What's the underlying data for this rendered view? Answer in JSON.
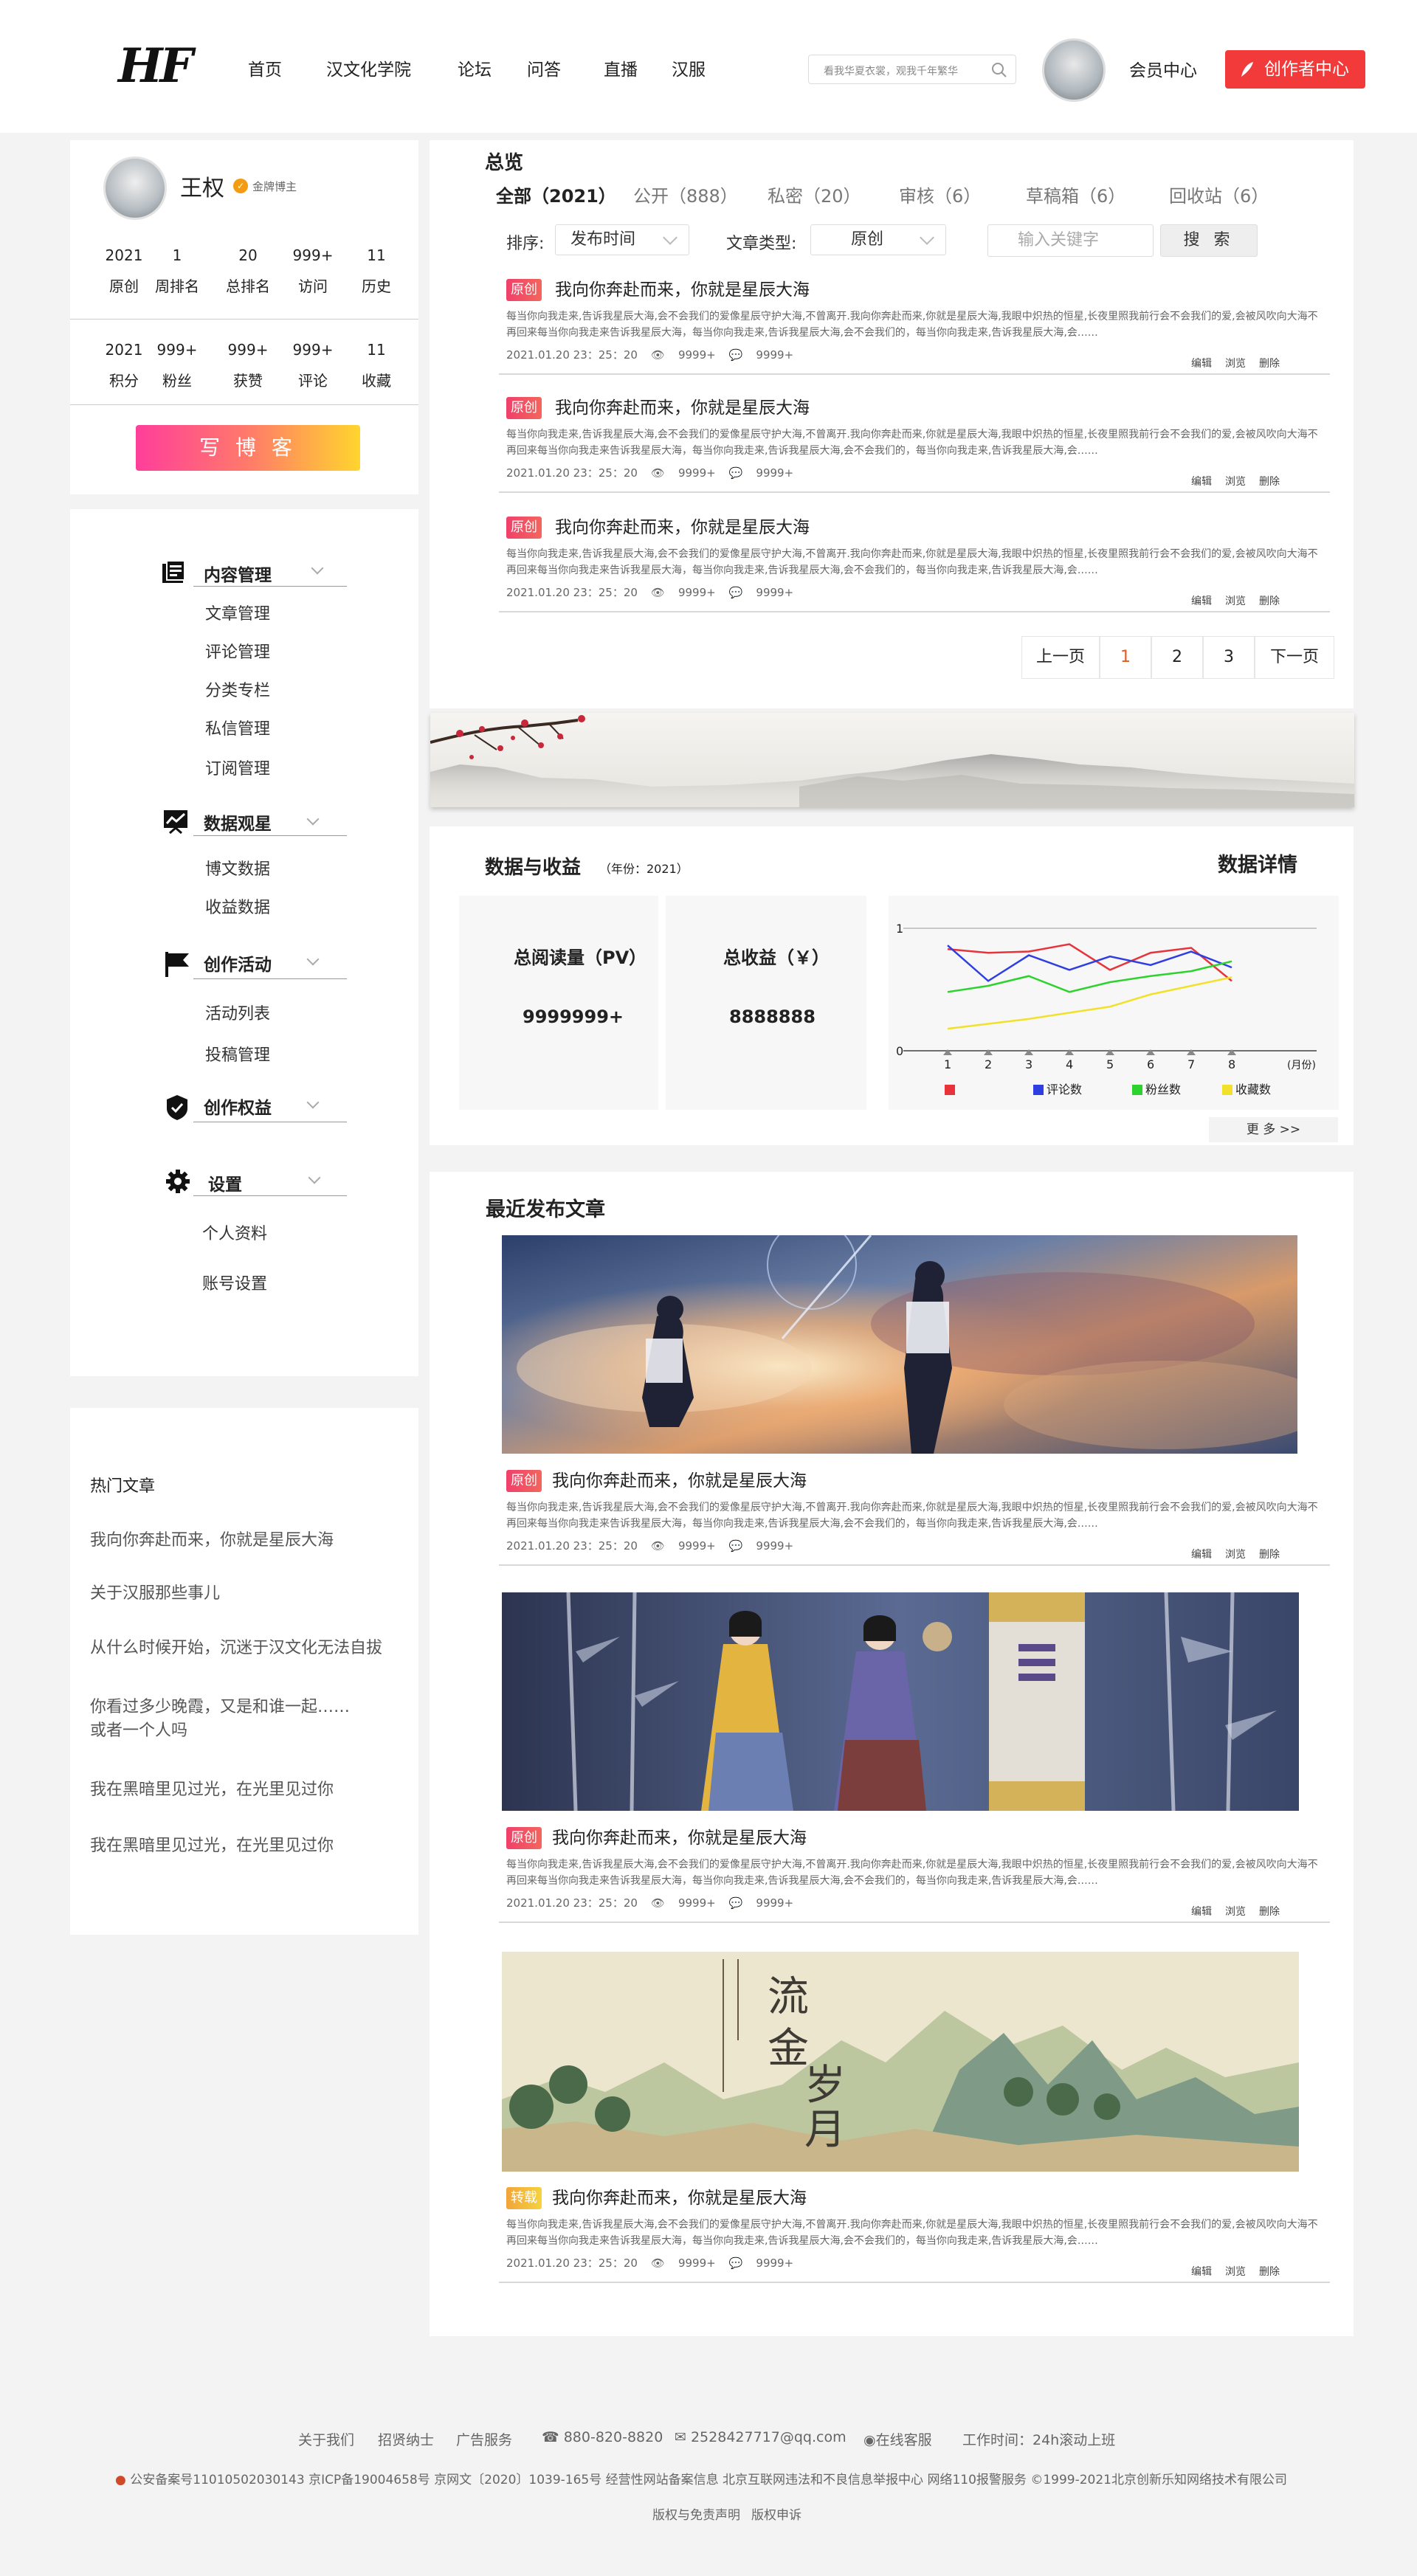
{
  "header": {
    "logo": "HF",
    "nav": [
      "首页",
      "汉文化学院",
      "论坛",
      "问答",
      "直播",
      "汉服"
    ],
    "search_placeholder": "看我华夏衣裳，观我千年繁华",
    "member_center": "会员中心",
    "creator_center": "创作者中心"
  },
  "profile": {
    "name": "王权",
    "badge": "金牌博主",
    "stats_row1": [
      {
        "value": "2021",
        "label": "原创"
      },
      {
        "value": "1",
        "label": "周排名"
      },
      {
        "value": "20",
        "label": "总排名"
      },
      {
        "value": "999+",
        "label": "访问"
      },
      {
        "value": "11",
        "label": "历史"
      }
    ],
    "stats_row2": [
      {
        "value": "2021",
        "label": "积分"
      },
      {
        "value": "999+",
        "label": "粉丝"
      },
      {
        "value": "999+",
        "label": "获赞"
      },
      {
        "value": "999+",
        "label": "评论"
      },
      {
        "value": "11",
        "label": "收藏"
      }
    ],
    "write_button": "写 博 客"
  },
  "menu": {
    "sections": [
      {
        "title": "内容管理",
        "icon": "document-icon",
        "items": [
          "文章管理",
          "评论管理",
          "分类专栏",
          "私信管理",
          "订阅管理"
        ]
      },
      {
        "title": "数据观星",
        "icon": "chart-icon",
        "items": [
          "博文数据",
          "收益数据"
        ]
      },
      {
        "title": "创作活动",
        "icon": "flag-icon",
        "items": [
          "活动列表",
          "投稿管理"
        ]
      },
      {
        "title": "创作权益",
        "icon": "medal-icon",
        "items": []
      },
      {
        "title": "设置",
        "icon": "gear-icon",
        "items": [
          "个人资料",
          "账号设置"
        ]
      }
    ]
  },
  "hot": {
    "title": "热门文章",
    "items": [
      "我向你奔赴而来，你就是星辰大海",
      "关于汉服那些事儿",
      "从什么时候开始，沉迷于汉文化无法自拔",
      "你看过多少晚霞，又是和谁一起……",
      "或者一个人吗",
      "我在黑暗里见过光，在光里见过你",
      "我在黑暗里见过光，在光里见过你"
    ]
  },
  "overview": {
    "title": "总览",
    "tabs": [
      "全部（2021）",
      "公开（888）",
      "私密（20）",
      "审核（6）",
      "草稿箱（6）",
      "回收站（6）"
    ],
    "sort_label": "排序:",
    "sort_value": "发布时间",
    "type_label": "文章类型:",
    "type_value": "原创",
    "keyword_placeholder": "输入关键字",
    "search_button": "搜 索"
  },
  "article": {
    "tag_original": "原创",
    "tag_repost": "转载",
    "title": "我向你奔赴而来，你就是星辰大海",
    "excerpt": "每当你向我走来,告诉我星辰大海,会不会我们的爱像星辰守护大海,不曾离开.我向你奔赴而来,你就是星辰大海,我眼中炽热的恒星,长夜里照我前行会不会我们的爱,会被风吹向大海不再回来每当你向我走来告诉我星辰大海，每当你向我走来,告诉我星辰大海,会不会我们的，每当你向我走来,告诉我星辰大海,会……",
    "date": "2021.01.20  23：25：20",
    "views": "9999+",
    "comments": "9999+",
    "ops": [
      "编辑",
      "浏览",
      "删除"
    ]
  },
  "pagination": {
    "prev": "上一页",
    "pages": [
      "1",
      "2",
      "3"
    ],
    "next": "下一页"
  },
  "data": {
    "title": "数据与收益",
    "year": "（年份：2021）",
    "detail_title": "数据详情",
    "reads_label": "总阅读量（PV）",
    "reads_value": "9999999+",
    "income_label": "总收益（￥）",
    "income_value": "8888888",
    "more": "更 多 >>"
  },
  "chart_data": {
    "type": "line",
    "x": [
      1,
      2,
      3,
      4,
      5,
      6,
      7,
      8
    ],
    "x_unit": "(月份)",
    "y_ticks": [
      "0",
      "1"
    ],
    "series": [
      {
        "name": "",
        "color": "#e8333a",
        "values": [
          0.83,
          0.8,
          0.81,
          0.87,
          0.66,
          0.8,
          0.84,
          0.57
        ]
      },
      {
        "name": "评论数",
        "color": "#2f3ee0",
        "values": [
          0.86,
          0.57,
          0.78,
          0.66,
          0.77,
          0.7,
          0.81,
          0.68
        ]
      },
      {
        "name": "粉丝数",
        "color": "#2ed22e",
        "values": [
          0.48,
          0.53,
          0.61,
          0.48,
          0.56,
          0.61,
          0.65,
          0.73
        ]
      },
      {
        "name": "收藏数",
        "color": "#f2e12a",
        "values": [
          0.18,
          0.22,
          0.26,
          0.31,
          0.36,
          0.46,
          0.53,
          0.6
        ]
      }
    ]
  },
  "recent": {
    "title": "最近发布文章"
  },
  "footer": {
    "links": [
      "关于我们",
      "招贤纳士",
      "广告服务"
    ],
    "phone": "880-820-8820",
    "email": "2528427717@qq.com",
    "service": "在线客服",
    "hours": "工作时间：24h滚动上班",
    "icp": "公安备案号11010502030143  京ICP备19004658号  京网文〔2020〕1039-165号  经营性网站备案信息  北京互联网违法和不良信息举报中心  网络110报警服务  ©1999-2021北京创新乐知网络技术有限公司",
    "legal": [
      "版权与免责声明",
      "版权申诉"
    ]
  }
}
